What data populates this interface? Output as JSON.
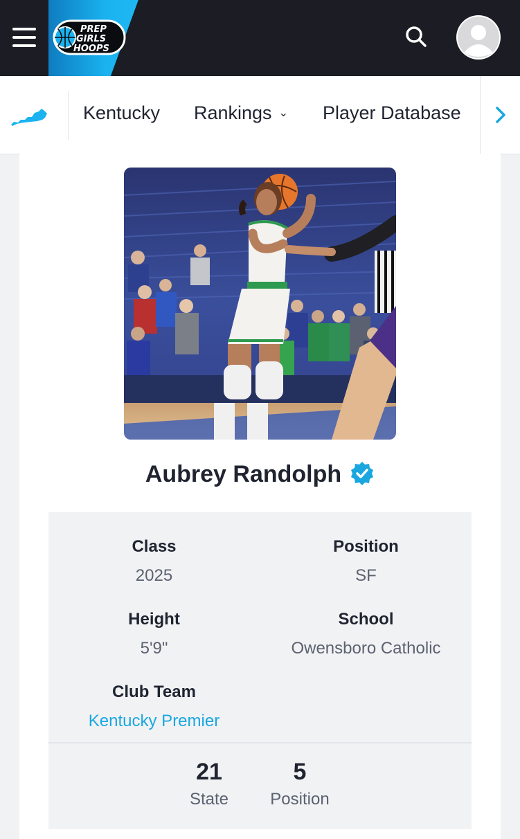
{
  "header": {
    "logo_lines": [
      "PREP",
      "GIRLS",
      "HOOPS"
    ],
    "icons": {
      "menu": "hamburger-menu-icon",
      "search": "search-icon",
      "avatar": "user-avatar-icon"
    },
    "colors": {
      "bar": "#1c1d24",
      "accent": "#1ab3f0"
    }
  },
  "subnav": {
    "state_icon": "kentucky-map-icon",
    "items": [
      {
        "label": "Kentucky"
      },
      {
        "label": "Rankings"
      },
      {
        "label": "Player Database"
      }
    ],
    "next_icon": "chevron-right-icon"
  },
  "player": {
    "photo_alt": "player-photo",
    "name": "Aubrey Randolph",
    "verified_icon": "verified-check-icon",
    "details": {
      "class_label": "Class",
      "class_value": "2025",
      "position_label": "Position",
      "position_value": "SF",
      "height_label": "Height",
      "height_value": "5'9\"",
      "school_label": "School",
      "school_value": "Owensboro Catholic",
      "club_label": "Club Team",
      "club_value": "Kentucky Premier"
    },
    "rankings": {
      "state_value": "21",
      "state_label": "State",
      "position_value": "5",
      "position_label": "Position"
    }
  },
  "colors": {
    "link": "#1aa7e0",
    "verified": "#1aa7e0"
  }
}
